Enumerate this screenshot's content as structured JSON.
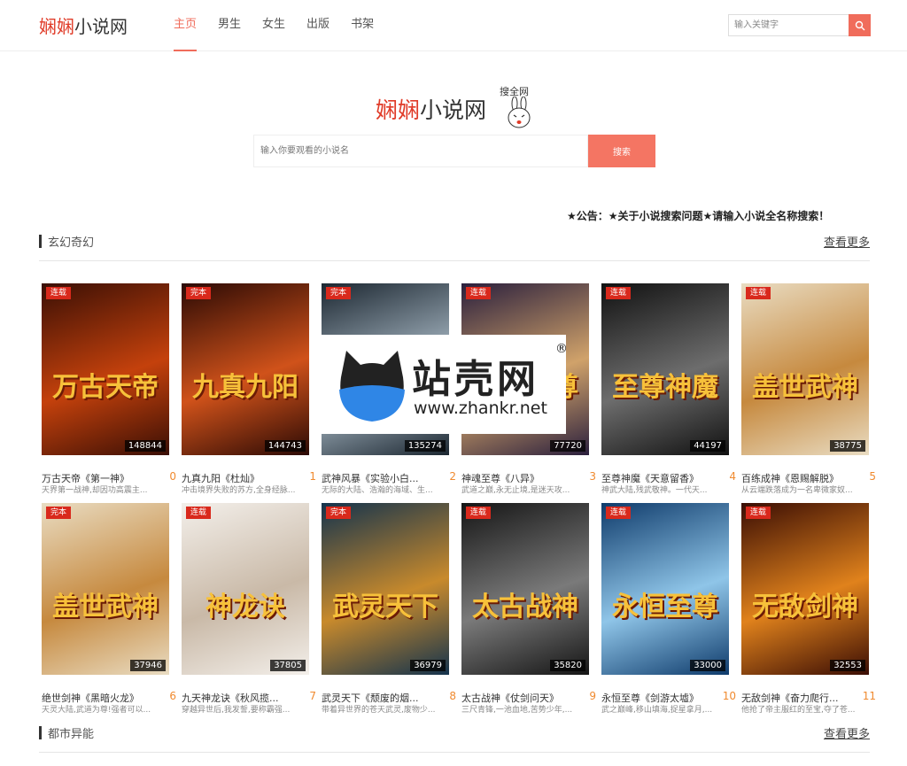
{
  "header": {
    "logo_red": "娴娴",
    "logo_dark": "小说网",
    "nav": [
      {
        "label": "主页",
        "active": true
      },
      {
        "label": "男生",
        "active": false
      },
      {
        "label": "女生",
        "active": false
      },
      {
        "label": "出版",
        "active": false
      },
      {
        "label": "书架",
        "active": false
      }
    ],
    "search_placeholder": "输入关键字"
  },
  "hero": {
    "logo_red": "娴娴",
    "logo_dark": "小说网",
    "logo_sub": "搜全网",
    "search_placeholder": "输入你要观看的小说名",
    "search_button": "搜索"
  },
  "notice": "★公告：★关于小说搜索问题★请输入小说全名称搜索！",
  "sections": [
    {
      "title": "玄幻奇幻",
      "more": "查看更多"
    },
    {
      "title": "都市异能",
      "more": "查看更多"
    }
  ],
  "books": [
    {
      "status": "连载",
      "count": "148844",
      "name": "万古天帝《第一神》",
      "rank": "0",
      "desc": "天界第一战神,却因功高震主...",
      "cover_text": "万古天帝",
      "colors": [
        "#3a0f05",
        "#c4410c"
      ]
    },
    {
      "status": "完本",
      "count": "144743",
      "name": "九真九阳《杜灿》",
      "rank": "1",
      "desc": "冲击境界失败的苏方,全身经脉...",
      "cover_text": "九真九阳",
      "colors": [
        "#2b0a05",
        "#d0521a"
      ]
    },
    {
      "status": "完本",
      "count": "135274",
      "name": "武神风暴《实验小白...",
      "rank": "2",
      "desc": "无际的大陆、浩瀚的海域、生...",
      "cover_text": "武神风暴",
      "colors": [
        "#1c2731",
        "#a8b8c4"
      ]
    },
    {
      "status": "连载",
      "count": "77720",
      "name": "神魂至尊《八异》",
      "rank": "3",
      "desc": "武道之巅,永无止境,是迷天攻...",
      "cover_text": "神魂至尊",
      "colors": [
        "#2a1f3d",
        "#d0a26a"
      ]
    },
    {
      "status": "连载",
      "count": "44197",
      "name": "至尊神魔《天意留香》",
      "rank": "4",
      "desc": "神武大陆,残武敬神。一代天...",
      "cover_text": "至尊神魔",
      "colors": [
        "#111111",
        "#6d6d6d"
      ]
    },
    {
      "status": "连载",
      "count": "38775",
      "name": "百练成神《恩赐解脱》",
      "rank": "5",
      "desc": "从云端跌落成为一名卑微家奴...",
      "cover_text": "盖世武神",
      "colors": [
        "#e9dcc2",
        "#c6893e"
      ]
    },
    {
      "status": "完本",
      "count": "37946",
      "name": "绝世剑神《黑暗火龙》",
      "rank": "6",
      "desc": "天灵大陆,武道为尊!强者可以...",
      "cover_text": "盖世武神",
      "colors": [
        "#e9dcc2",
        "#c6893e"
      ]
    },
    {
      "status": "连载",
      "count": "37805",
      "name": "九天神龙诀《秋风揽...",
      "rank": "7",
      "desc": "穿越异世后,我发誓,要称霸强...",
      "cover_text": "神龙诀",
      "colors": [
        "#f3efea",
        "#c9b9a7"
      ]
    },
    {
      "status": "完本",
      "count": "36979",
      "name": "武灵天下《颓废的烟...",
      "rank": "8",
      "desc": "带着异世界的苍天武灵,废物少...",
      "cover_text": "武灵天下",
      "colors": [
        "#14334d",
        "#c88a2c"
      ]
    },
    {
      "status": "连载",
      "count": "35820",
      "name": "太古战神《仗剑问天》",
      "rank": "9",
      "desc": "三尺青锋,一池血地,苦势少年,...",
      "cover_text": "太古战神",
      "colors": [
        "#151515",
        "#7a7a7a"
      ]
    },
    {
      "status": "连载",
      "count": "33000",
      "name": "永恒至尊《剑游太墟》",
      "rank": "10",
      "desc": "武之巅峰,移山填海,捉星拿月,...",
      "cover_text": "永恒至尊",
      "colors": [
        "#0f3b6b",
        "#8fc5e8"
      ]
    },
    {
      "status": "连载",
      "count": "32553",
      "name": "无敌剑神《奋力爬行...",
      "rank": "11",
      "desc": "他抢了帝主服红的至宝,夺了苍...",
      "cover_text": "无敌剑神",
      "colors": [
        "#3a0d04",
        "#e0821c"
      ]
    }
  ],
  "watermark": {
    "name": "站壳网",
    "url": "www.zhankr.net",
    "reg": "®"
  }
}
